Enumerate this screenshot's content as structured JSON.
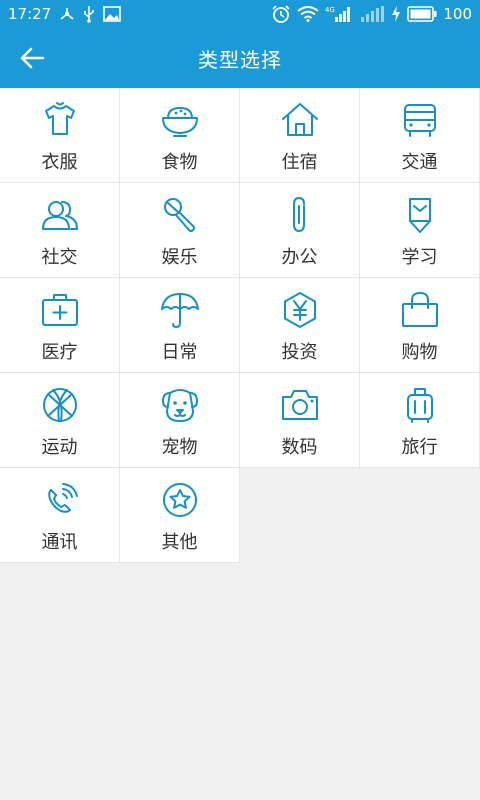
{
  "status_bar": {
    "time": "17:27",
    "network": "4G",
    "battery": "100"
  },
  "header": {
    "title": "类型选择"
  },
  "categories": [
    {
      "label": "衣服",
      "icon": "shirt-icon"
    },
    {
      "label": "食物",
      "icon": "bowl-icon"
    },
    {
      "label": "住宿",
      "icon": "house-icon"
    },
    {
      "label": "交通",
      "icon": "bus-icon"
    },
    {
      "label": "社交",
      "icon": "people-icon"
    },
    {
      "label": "娱乐",
      "icon": "microphone-icon"
    },
    {
      "label": "办公",
      "icon": "paperclip-icon"
    },
    {
      "label": "学习",
      "icon": "pencil-icon"
    },
    {
      "label": "医疗",
      "icon": "medical-kit-icon"
    },
    {
      "label": "日常",
      "icon": "umbrella-icon"
    },
    {
      "label": "投资",
      "icon": "yen-icon"
    },
    {
      "label": "购物",
      "icon": "shopping-bag-icon"
    },
    {
      "label": "运动",
      "icon": "basketball-icon"
    },
    {
      "label": "宠物",
      "icon": "dog-icon"
    },
    {
      "label": "数码",
      "icon": "camera-icon"
    },
    {
      "label": "旅行",
      "icon": "luggage-icon"
    },
    {
      "label": "通讯",
      "icon": "phone-icon"
    },
    {
      "label": "其他",
      "icon": "star-icon"
    }
  ],
  "colors": {
    "primary": "#1a9ad6",
    "icon": "#1790c8",
    "text": "#333333",
    "background": "#f0f0f0"
  }
}
